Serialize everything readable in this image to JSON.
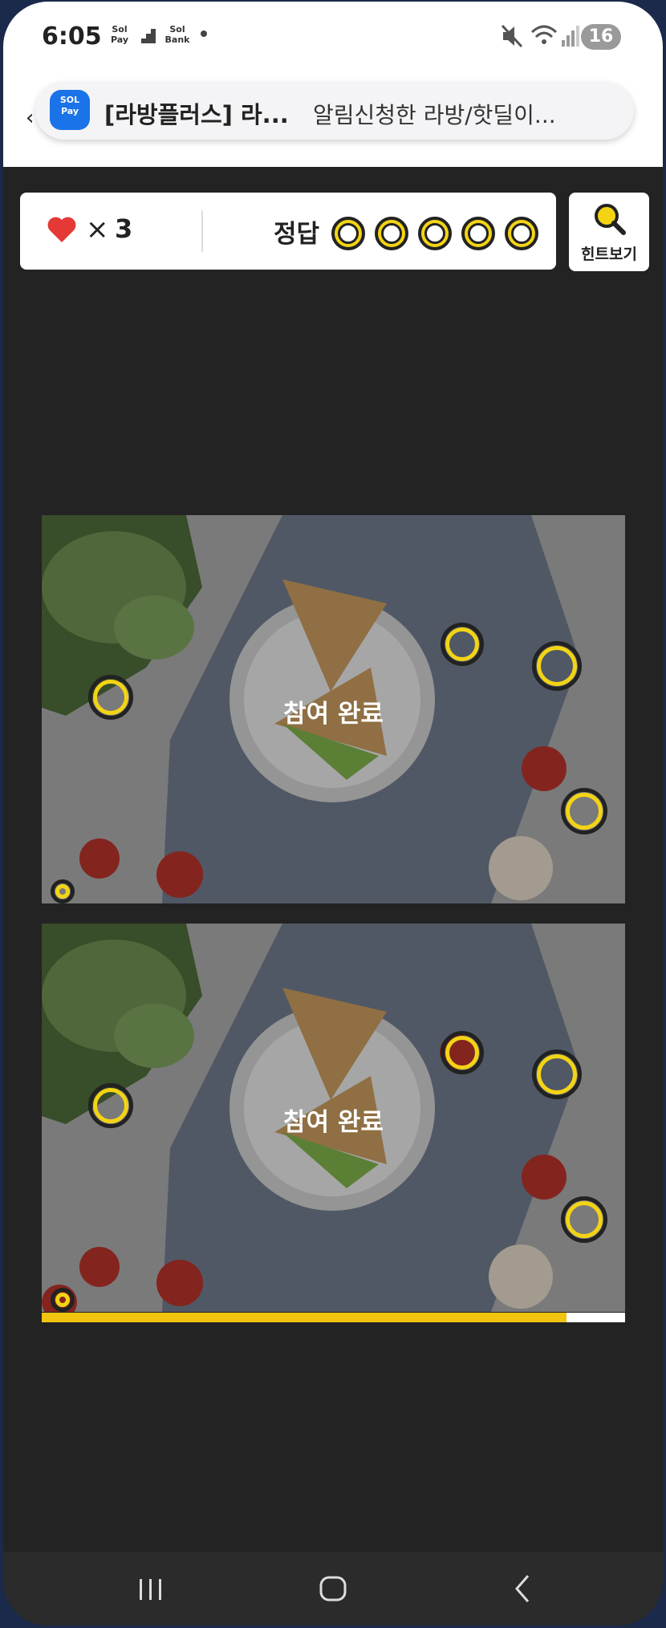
{
  "status_bar": {
    "time": "6:05",
    "apps": [
      "Sol Pay",
      "Sol Bank"
    ],
    "battery": "16"
  },
  "notification": {
    "title": "[라방플러스] 라...",
    "body": "알림신청한 라방/핫딜이..."
  },
  "header": {
    "lives_symbol": "×",
    "lives": "3",
    "answer_label": "정답",
    "answer_slots": 5,
    "hint_label": "힌트보기"
  },
  "images": [
    {
      "overlay_text": "참여 완료"
    },
    {
      "overlay_text": "참여 완료"
    }
  ],
  "progress": 0.9,
  "colors": {
    "accent": "#f3d414",
    "heart": "#e53935",
    "background": "#232323"
  },
  "nav": {
    "recents_icon": "recents-icon",
    "home_icon": "home-icon",
    "back_icon": "back-icon"
  }
}
